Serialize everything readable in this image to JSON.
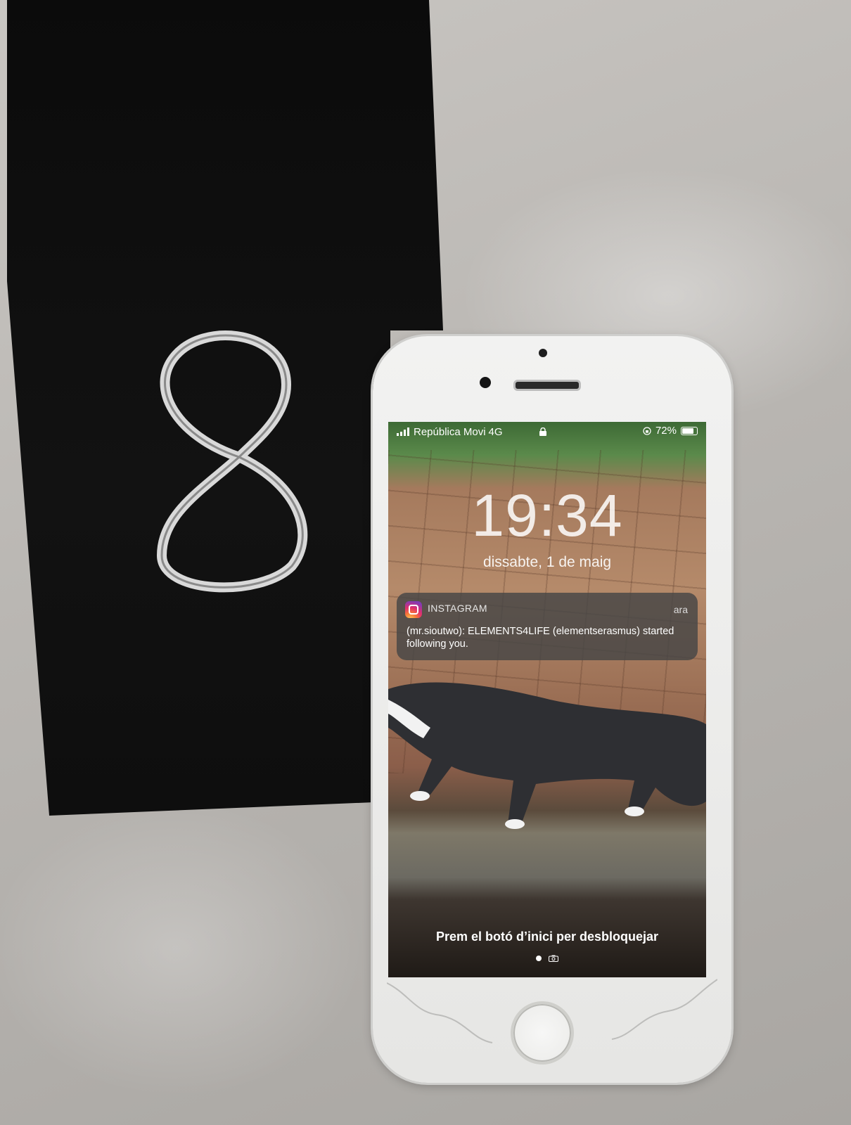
{
  "card": {
    "numeral": "8"
  },
  "status_bar": {
    "carrier": "República Movi",
    "network": "4G",
    "battery": "72%",
    "battery_level": 0.72
  },
  "lock_screen": {
    "time": "19:34",
    "date": "dissabte, 1 de maig",
    "unlock_hint": "Prem el botó d’inici per desbloquejar"
  },
  "notification": {
    "app": "INSTAGRAM",
    "time": "ara",
    "message": "(mr.sioutwo): ELEMENTS4LIFE (elementserasmus) started following you."
  },
  "icons": {
    "signal": "signal-bars-icon",
    "lock": "lock-icon",
    "rotation_lock": "rotation-lock-icon",
    "battery": "battery-icon",
    "instagram": "instagram-icon",
    "camera": "camera-icon"
  }
}
